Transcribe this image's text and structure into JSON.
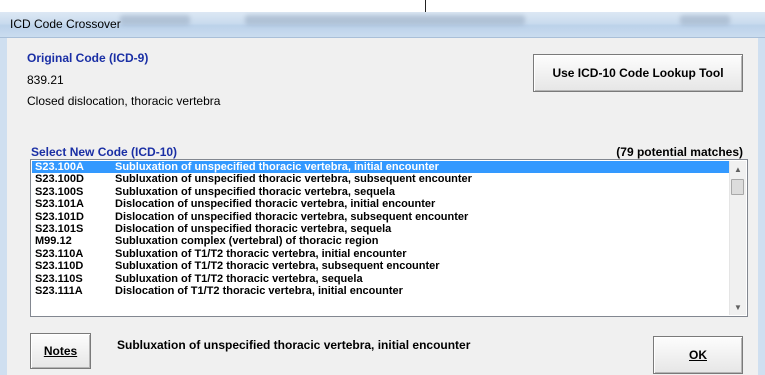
{
  "window": {
    "title": "ICD Code Crossover"
  },
  "original": {
    "label": "Original Code (ICD-9)",
    "code": "839.21",
    "description": "Closed dislocation, thoracic vertebra"
  },
  "buttons": {
    "lookup": "Use ICD-10 Code Lookup Tool",
    "notes": "Notes",
    "ok": "OK"
  },
  "select": {
    "label": "Select New Code (ICD-10)",
    "matches": "(79 potential matches)",
    "selected_index": 0,
    "items": [
      {
        "code": "S23.100A",
        "desc": "Subluxation of unspecified thoracic vertebra, initial encounter"
      },
      {
        "code": "S23.100D",
        "desc": "Subluxation of unspecified thoracic vertebra, subsequent encounter"
      },
      {
        "code": "S23.100S",
        "desc": "Subluxation of unspecified thoracic vertebra, sequela"
      },
      {
        "code": "S23.101A",
        "desc": "Dislocation of unspecified thoracic vertebra, initial encounter"
      },
      {
        "code": "S23.101D",
        "desc": "Dislocation of unspecified thoracic vertebra, subsequent encounter"
      },
      {
        "code": "S23.101S",
        "desc": "Dislocation of unspecified thoracic vertebra, sequela"
      },
      {
        "code": "M99.12",
        "desc": "Subluxation complex (vertebral) of thoracic region"
      },
      {
        "code": "S23.110A",
        "desc": "Subluxation of T1/T2 thoracic vertebra, initial encounter"
      },
      {
        "code": "S23.110D",
        "desc": "Subluxation of T1/T2 thoracic vertebra, subsequent encounter"
      },
      {
        "code": "S23.110S",
        "desc": "Subluxation of T1/T2 thoracic vertebra, sequela"
      },
      {
        "code": "S23.111A",
        "desc": "Dislocation of T1/T2 thoracic vertebra, initial encounter"
      }
    ]
  },
  "selected_description": "Subluxation of unspecified thoracic vertebra, initial encounter",
  "icons": {
    "scroll_up": "scroll-up-arrow-icon",
    "scroll_down": "scroll-down-arrow-icon"
  },
  "colors": {
    "label_blue": "#1a2fa5",
    "selection": "#3399ff"
  }
}
